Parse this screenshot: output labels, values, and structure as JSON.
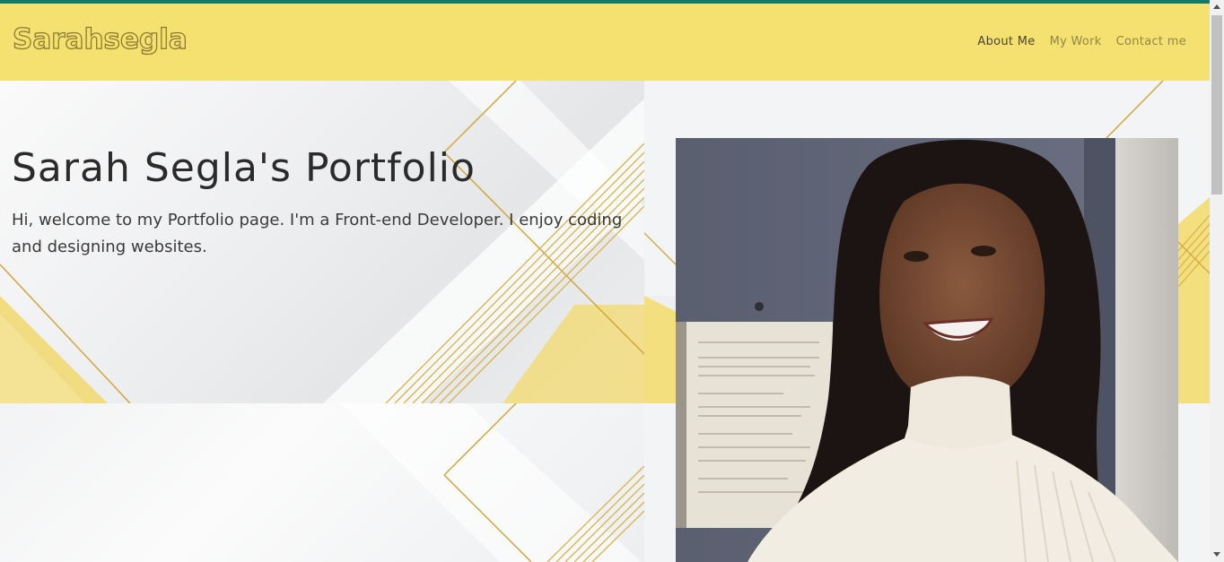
{
  "brand": {
    "logo_text": "Sarahsegla"
  },
  "nav": {
    "items": [
      {
        "label": "About Me",
        "active": true
      },
      {
        "label": "My Work",
        "active": false
      },
      {
        "label": "Contact me",
        "active": false
      }
    ]
  },
  "hero": {
    "title": "Sarah Segla's Portfolio",
    "intro": "Hi, welcome to my Portfolio page. I'm a Front-end Developer. I enjoy coding and designing websites."
  },
  "colors": {
    "accent_yellow": "#f5e16f",
    "top_stripe": "#137a6a",
    "gold_line": "#d2a63a"
  }
}
